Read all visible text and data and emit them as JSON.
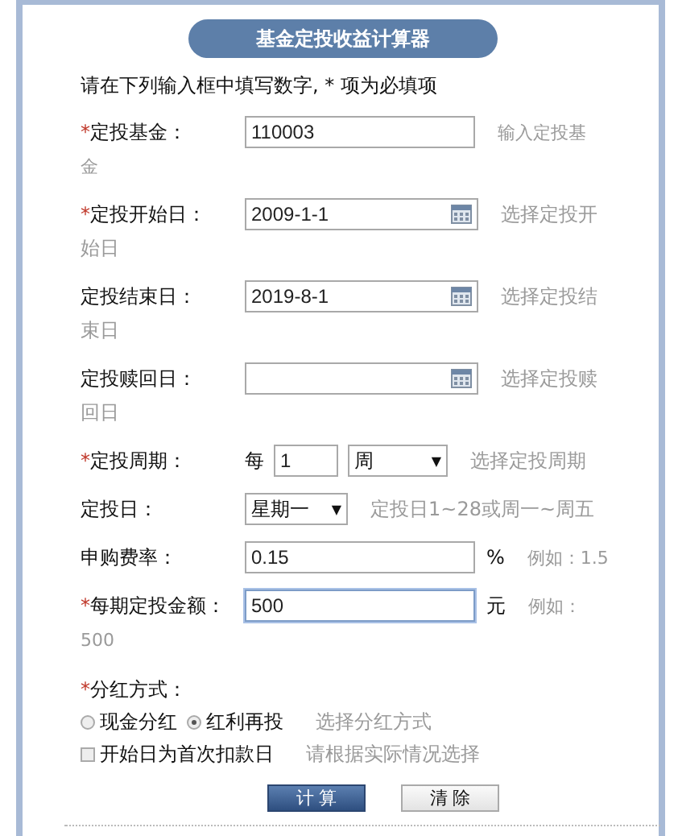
{
  "title": "基金定投收益计算器",
  "intro": "请在下列输入框中填写数字, * 项为必填项",
  "fields": [
    {
      "kind": "text",
      "mark": "*",
      "label": "定投基金：",
      "value": "110003",
      "hint": [
        "输入定投基",
        "金"
      ]
    },
    {
      "kind": "date",
      "mark": "*",
      "label": "定投开始日：",
      "value": "2009-1-1",
      "hint": [
        "选择定投开",
        "始日"
      ]
    },
    {
      "kind": "date",
      "label": "定投结束日：",
      "value": "2019-8-1",
      "hint": [
        "选择定投结",
        "束日"
      ]
    },
    {
      "kind": "date",
      "label": "定投赎回日：",
      "hint": [
        "选择定投赎",
        "回日"
      ]
    },
    {
      "kind": "period",
      "mark": "*",
      "label": "定投周期：",
      "prefix": "每",
      "value": "1",
      "unit": "周",
      "caret": "▼",
      "hint": [
        "选择定投周期"
      ]
    },
    {
      "kind": "select",
      "label": "定投日：",
      "value": "星期一",
      "caret": "▼",
      "hint": [
        "定投日1~28或周一~周五"
      ]
    },
    {
      "kind": "text",
      "label": "申购费率：",
      "value": "0.15",
      "suffix": "%",
      "hint": [
        "例如：1.5"
      ],
      "focused": false
    },
    {
      "kind": "text",
      "mark": "*",
      "label": "每期定投金额：",
      "value": "500",
      "suffix": "元",
      "hint": [
        "例如：",
        "500"
      ],
      "focused": true
    }
  ],
  "dividend": {
    "mark": "*",
    "label": "分红方式：",
    "options": [
      {
        "label": "现金分红",
        "selected": false
      },
      {
        "label": "红利再投",
        "selected": true
      }
    ],
    "hint": "选择分红方式"
  },
  "first_day": {
    "label": "开始日为首次扣款日",
    "checked": false,
    "hint": "请根据实际情况选择"
  },
  "buttons": [
    {
      "label": "计 算",
      "kind": "primary"
    },
    {
      "label": "清 除",
      "kind": "secondary"
    }
  ]
}
